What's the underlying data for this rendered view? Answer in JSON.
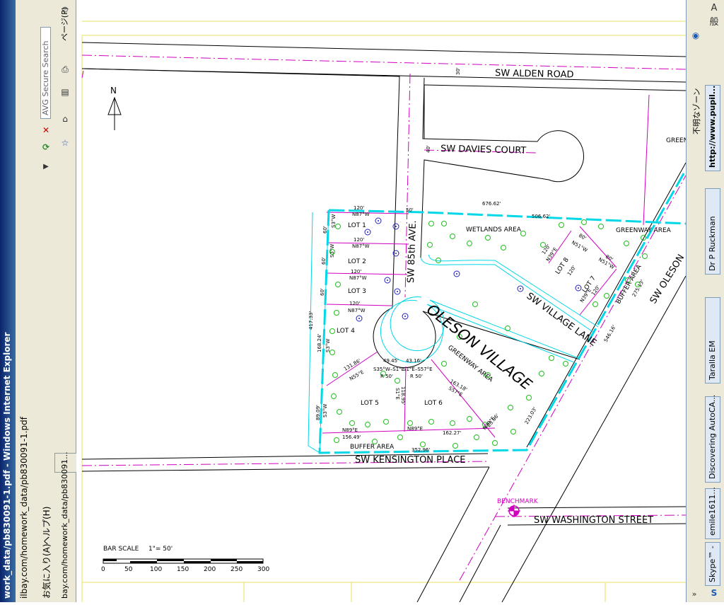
{
  "window": {
    "title": "work_data/pb830091-1.pdf - Windows Internet Explorer",
    "address": "ilbay.com/homework_data/pb830091-1.pdf",
    "tab_label": "bay.com/homework_data/pb830091...",
    "menu_favorites": "お気に入り(A)",
    "menu_help": "ヘルプ(H)",
    "search_placeholder": "AVG Secure Search",
    "page_menu": "ページ(P)",
    "right_label_1": "不明なゾーン",
    "right_label_2": "A 般"
  },
  "taskbar": {
    "items": [
      {
        "label": "http://www.pupil..."
      },
      {
        "label": "Dr P Ruckman"
      },
      {
        "label": "Taralla EM"
      },
      {
        "label": "Discovering AutoCA..."
      },
      {
        "label": "emile1611..."
      },
      {
        "label": "Skype™ -"
      }
    ]
  },
  "plan": {
    "streets": {
      "alden": "SW  ALDEN  ROAD",
      "davies": "SW  DAVIES  COURT",
      "avenue": "SW  85th  AVE.",
      "village_lane": "SW  VILLAGE  LANE",
      "oleson": "SW  OLESON",
      "kensington": "SW  KENSINGTON  PLACE",
      "washington": "SW  WASHINGTON  STREET"
    },
    "subdivision": "OLESON  VILLAGE",
    "areas": {
      "wetlands": "WETLANDS  AREA",
      "greenway_top": "GREENWAY  AREA",
      "greenway_mid": "GREENWAY  AREA",
      "greenway_corner": "GREEN",
      "buffer_right": "BUFFER  AREA",
      "buffer_bottom": "BUFFER  AREA"
    },
    "lots": [
      "LOT  1",
      "LOT  2",
      "LOT  3",
      "LOT  4",
      "LOT  5",
      "LOT  6",
      "LOT  7",
      "LOT  8"
    ],
    "benchmark": "BENCHMARK",
    "north": "N",
    "bar_scale": {
      "label": "BAR  SCALE",
      "ratio": "1\"=  50'",
      "ticks": [
        "0",
        "50",
        "100",
        "150",
        "200",
        "250",
        "300"
      ]
    },
    "dims": {
      "d120a": "120'",
      "n87a": "N87°W",
      "d120b": "120'",
      "n87b": "N87°W",
      "d120c": "120'",
      "n87c": "N87°W",
      "d120d": "120'",
      "n87d": "N87°W",
      "d60a": "60'",
      "d60b": "60'",
      "d60c": "60'",
      "s3a": "S3°W",
      "s3b": "S3°W",
      "s3c": "S3°W",
      "s3d": "S3°W",
      "d417": "417.33'",
      "d168": "168.24'",
      "d89": "89.09'",
      "d676": "676.62'",
      "d506": "506.62'",
      "d50": "50'",
      "d30": "30'",
      "d40": "40'",
      "d131": "131.86'",
      "n55": "N55°E",
      "d118": "118.95'",
      "s1e": "S1°E",
      "d163": "163.18'",
      "s57e": "S57°E",
      "d23": "23.06'",
      "n39e": "N39°E",
      "d156": "156.49'",
      "n89a": "N89°E",
      "n89b": "N89°E",
      "d162": "162.27'",
      "d352": "352.96'",
      "d223": "223.03'",
      "d546": "546.16'",
      "d275": "275.13'",
      "d49": "49.45'",
      "d43": "43.16'",
      "r50a": "R  50'",
      "r50b": "R  50'",
      "s35": "S35°W–S1°E",
      "s1ee": "S1°E–S57°E",
      "n39a": "N39°E",
      "n39b": "N39°E",
      "n51a": "N51°W",
      "n51b": "N51°W",
      "d80a": "80'",
      "d80b": "80'",
      "d120e": "120'",
      "d120f": "120'",
      "d120g": "120'"
    }
  }
}
